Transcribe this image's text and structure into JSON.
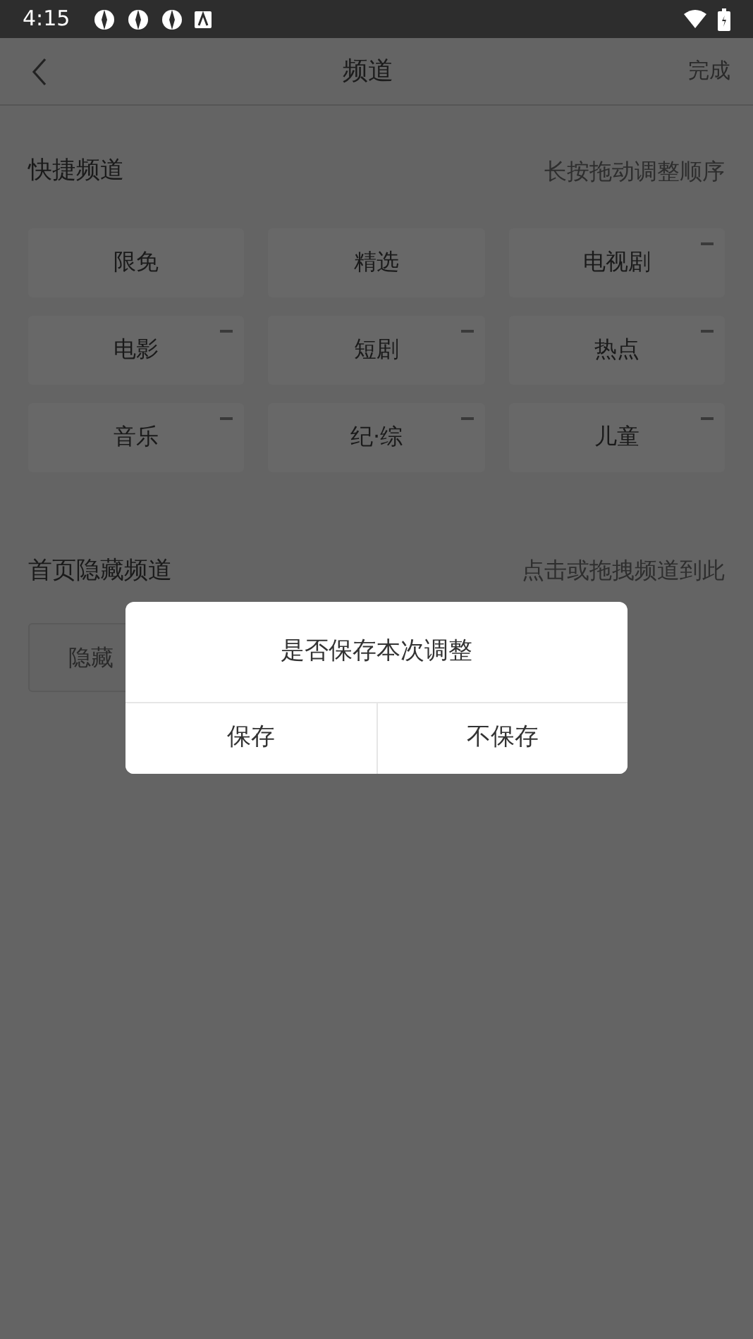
{
  "status_bar": {
    "time": "4:15"
  },
  "header": {
    "title": "频道",
    "action": "完成"
  },
  "quick_channels": {
    "title": "快捷频道",
    "hint": "长按拖动调整顺序",
    "items": [
      {
        "label": "限免",
        "removable": false
      },
      {
        "label": "精选",
        "removable": false
      },
      {
        "label": "电视剧",
        "removable": true
      },
      {
        "label": "电影",
        "removable": true
      },
      {
        "label": "短剧",
        "removable": true
      },
      {
        "label": "热点",
        "removable": true
      },
      {
        "label": "音乐",
        "removable": true
      },
      {
        "label": "纪·综",
        "removable": true
      },
      {
        "label": "儿童",
        "removable": true
      }
    ]
  },
  "hidden_channels": {
    "title": "首页隐藏频道",
    "hint": "点击或拖拽频道到此",
    "items": [
      {
        "label": "隐藏"
      }
    ]
  },
  "dialog": {
    "message": "是否保存本次调整",
    "buttons": [
      "保存",
      "不保存"
    ]
  }
}
